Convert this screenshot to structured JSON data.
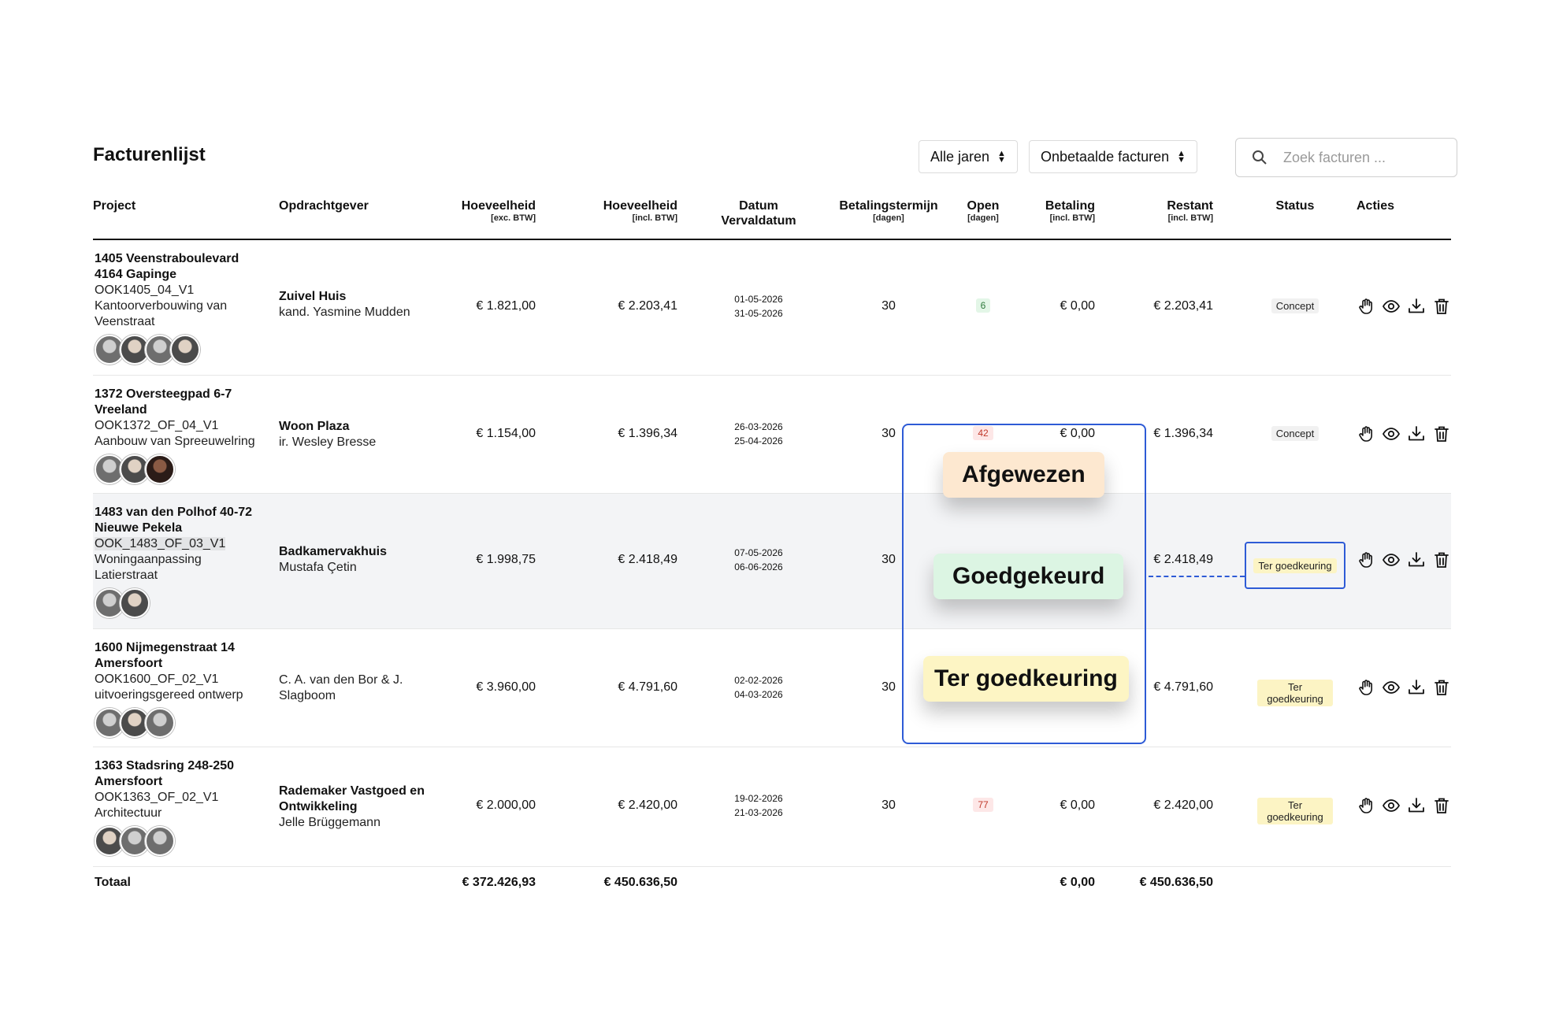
{
  "page": {
    "title": "Facturenlijst"
  },
  "filters": {
    "years": "Alle jaren",
    "invoices": "Onbetaalde facturen",
    "search_placeholder": "Zoek facturen ..."
  },
  "columns": {
    "project": "Project",
    "client": "Opdrachtgever",
    "amount_ex": {
      "label": "Hoeveelheid",
      "sub": "[exc. BTW]"
    },
    "amount_incl": {
      "label": "Hoeveelheid",
      "sub": "[incl. BTW]"
    },
    "date": {
      "label": "Datum",
      "sub": "Vervaldatum"
    },
    "term": {
      "label": "Betalingstermijn",
      "sub": "[dagen]"
    },
    "open": {
      "label": "Open",
      "sub": "[dagen]"
    },
    "payment": {
      "label": "Betaling",
      "sub": "[incl. BTW]"
    },
    "remaining": {
      "label": "Restant",
      "sub": "[incl. BTW]"
    },
    "status": "Status",
    "actions": "Acties"
  },
  "rows": [
    {
      "project_title": [
        "1405 Veenstraboulevard",
        "4164 Gapinge"
      ],
      "code": "OOK1405_04_V1",
      "description": [
        "Kantoorverbouwing van",
        "Veenstraat"
      ],
      "client_name": "Zuivel Huis",
      "client_contact": "kand. Yasmine Mudden",
      "amount_ex": "€ 1.821,00",
      "amount_incl": "€ 2.203,41",
      "date": "01-05-2026",
      "due_date": "31-05-2026",
      "term": "30",
      "open": "6",
      "payment": "€ 0,00",
      "remaining": "€ 2.203,41",
      "status": "Concept"
    },
    {
      "project_title": [
        "1372 Oversteegpad 6-7",
        "Vreeland"
      ],
      "code": "OOK1372_OF_04_V1",
      "description": [
        "Aanbouw van Spreeuwelring"
      ],
      "client_name": "Woon Plaza",
      "client_contact": "ir. Wesley Bresse",
      "amount_ex": "€ 1.154,00",
      "amount_incl": "€ 1.396,34",
      "date": "26-03-2026",
      "due_date": "25-04-2026",
      "term": "30",
      "open": "42",
      "payment": "€ 0,00",
      "remaining": "€ 1.396,34",
      "status": "Concept"
    },
    {
      "project_title": [
        "1483 van den Polhof 40-72",
        "Nieuwe Pekela"
      ],
      "code": "OOK_1483_OF_03_V1",
      "description": [
        "Woningaanpassing",
        "Latierstraat"
      ],
      "client_name": "Badkamervakhuis",
      "client_contact": "Mustafa Çetin",
      "amount_ex": "€ 1.998,75",
      "amount_incl": "€ 2.418,49",
      "date": "07-05-2026",
      "due_date": "06-06-2026",
      "term": "30",
      "remaining": "€ 2.418,49",
      "status": "Ter goedkeuring"
    },
    {
      "project_title": [
        "1600 Nijmegenstraat 14",
        "Amersfoort"
      ],
      "code": "OOK1600_OF_02_V1",
      "description": [
        "uitvoeringsgereed ontwerp"
      ],
      "client_name": "",
      "client_contact": [
        "C. A. van den Bor & J.",
        "Slagboom"
      ],
      "amount_ex": "€ 3.960,00",
      "amount_incl": "€ 4.791,60",
      "date": "02-02-2026",
      "due_date": "04-03-2026",
      "term": "30",
      "remaining": "€ 4.791,60",
      "status": "Ter goedkeuring"
    },
    {
      "project_title": [
        "1363 Stadsring 248-250",
        "Amersfoort"
      ],
      "code": "OOK1363_OF_02_V1",
      "description": [
        "Architectuur"
      ],
      "client_name": [
        "Rademaker Vastgoed en",
        "Ontwikkeling"
      ],
      "client_contact": "Jelle Brüggemann",
      "amount_ex": "€ 2.000,00",
      "amount_incl": "€ 2.420,00",
      "date": "19-02-2026",
      "due_date": "21-03-2026",
      "term": "30",
      "open": "77",
      "payment": "€ 0,00",
      "remaining": "€ 2.420,00",
      "status": "Ter goedkeuring"
    }
  ],
  "totals": {
    "label": "Totaal",
    "amount_ex": "€ 372.426,93",
    "amount_incl": "€ 450.636,50",
    "payment": "€ 0,00",
    "remaining": "€ 450.636,50"
  },
  "status_menu": {
    "rejected": "Afgewezen",
    "approved": "Goedgekeurd",
    "pending": "Ter goedkeuring"
  },
  "colors": {
    "accent": "#2e5bd6",
    "rejected_bg": "#fde8d0",
    "approved_bg": "#dcf5e3",
    "pending_bg": "#fdf5c4"
  },
  "icons": [
    "search-icon",
    "hand-icon",
    "eye-icon",
    "download-icon",
    "trash-icon"
  ]
}
